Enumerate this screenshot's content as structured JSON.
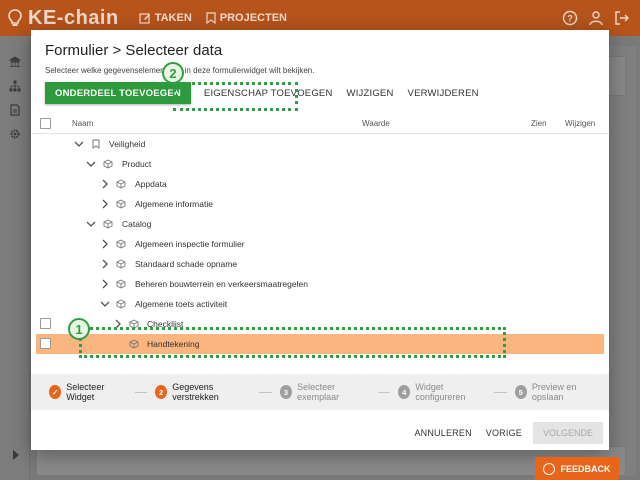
{
  "app": {
    "logo_text": "KE-chain",
    "nav": [
      {
        "label": "TAKEN",
        "icon": "edit-icon"
      },
      {
        "label": "PROJECTEN",
        "icon": "bookmark-icon"
      }
    ],
    "top_icons": [
      "help-icon",
      "user-icon",
      "logout-icon"
    ],
    "sidebar_icons": [
      "bank-icon",
      "sitemap-icon",
      "document-icon",
      "gear-icon"
    ],
    "brand_color": "#e8651a"
  },
  "modal": {
    "title": "Formulier > Selecteer data",
    "description": "Selecteer welke gegevenselementen u in deze formulierwidget wilt bekijken.",
    "toolbar": {
      "add_part": "ONDERDEEL TOEVOEGEN",
      "add_property": "EIGENSCHAP TOEVOEGEN",
      "edit": "WIJZIGEN",
      "delete": "VERWIJDEREN"
    },
    "table": {
      "columns": [
        "Naam",
        "Waarde",
        "Zien",
        "Wijzigen"
      ]
    },
    "tree": [
      {
        "label": "Veiligheid",
        "icon": "bookmark-icon",
        "expanded": true
      },
      {
        "label": "Product",
        "icon": "cube-icon",
        "expanded": true
      },
      {
        "label": "Appdata",
        "icon": "cube-icon",
        "expanded": false
      },
      {
        "label": "Algemene informatie",
        "icon": "cube-icon",
        "expanded": false
      },
      {
        "label": "Catalog",
        "icon": "cube-icon",
        "expanded": true
      },
      {
        "label": "Algemeen inspectie formulier",
        "icon": "cube-icon",
        "expanded": false
      },
      {
        "label": "Standaard schade opname",
        "icon": "cube-icon",
        "expanded": false
      },
      {
        "label": "Beheren bouwterrein en verkeersmaatregelen",
        "icon": "cube-icon",
        "expanded": false
      },
      {
        "label": "Algemene toets activiteit",
        "icon": "cube-icon",
        "expanded": true
      },
      {
        "label": "Checklijst",
        "icon": "cube-icon",
        "expanded": false
      },
      {
        "label": "Handtekening",
        "icon": "cube-icon",
        "selected": true
      }
    ],
    "steps": [
      {
        "num": "✓",
        "label": "Selecteer Widget",
        "state": "done"
      },
      {
        "num": "2",
        "label": "Gegevens verstrekken",
        "state": "active"
      },
      {
        "num": "3",
        "label": "Selecteer exemplaar",
        "state": "todo"
      },
      {
        "num": "4",
        "label": "Widget configureren",
        "state": "todo"
      },
      {
        "num": "5",
        "label": "Preview en opslaan",
        "state": "todo"
      }
    ],
    "footer": {
      "cancel": "ANNULEREN",
      "previous": "VORIGE",
      "next": "VOLGENDE"
    }
  },
  "annotations": [
    {
      "label": "1"
    },
    {
      "label": "2"
    }
  ],
  "feedback_label": "FEEDBACK",
  "colors": {
    "primary_green": "#2e9a3e",
    "selected_row": "#fbb57f",
    "step_active": "#e8651a",
    "step_todo": "#9e9e9e",
    "annotation": "#2f9e44"
  }
}
